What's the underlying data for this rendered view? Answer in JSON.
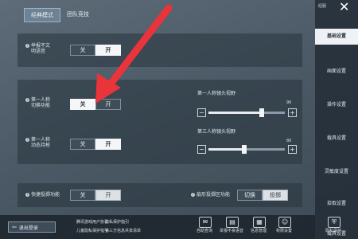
{
  "mode_tabs": {
    "classic": "经典模式",
    "team": "团队竞技"
  },
  "top_bar": {
    "badge": "经服"
  },
  "settings": {
    "report_voice": {
      "label_line1": "举报不文",
      "label_line2": "明语音",
      "off": "关",
      "on": "开"
    },
    "first_person_switch": {
      "label_line1": "第一人称",
      "label_line2": "切换功能",
      "off": "关",
      "on": "开"
    },
    "first_person_hold": {
      "label_line1": "第一人称",
      "label_line2": "动态持枪",
      "off": "关",
      "on": "开"
    },
    "quick_mark": {
      "label": "快捷投掷功能",
      "off": "关",
      "on": "开"
    },
    "throw_mode": {
      "label": "扇形投掷区功能",
      "opt1": "切换",
      "opt2": "投掷"
    }
  },
  "sliders": {
    "first_person_fov": {
      "title": "第一人称镜头视野",
      "value": 90,
      "max_label": "90",
      "min": 60,
      "max": 103,
      "minus": "−",
      "plus": "+"
    },
    "third_person_fov": {
      "title": "第三人称镜头视野",
      "value": 80,
      "max_label": "80",
      "min": 60,
      "max": 103,
      "minus": "−",
      "plus": "+"
    }
  },
  "sidebar": {
    "items": [
      "基础设置",
      "画面设置",
      "操作设置",
      "载具设置",
      "灵敏度设置",
      "拾取设置",
      "载具设置"
    ]
  },
  "footer": {
    "logout": "退出登录",
    "links": [
      "腾讯游戏用户协议",
      "隐私保护指引",
      "儿童隐私保护指引",
      "第三方信息共享清单"
    ],
    "icons": [
      {
        "name": "message-icon",
        "label": "自助查询"
      },
      {
        "name": "book-icon",
        "label": "举报不良语音"
      },
      {
        "name": "data-icon",
        "label": "信息管理"
      },
      {
        "name": "person-icon",
        "label": "权限设置"
      },
      {
        "name": "shield-icon",
        "label": "隐私保护"
      }
    ]
  },
  "colors": {
    "annotation_arrow": "#e8343a",
    "panel": "#28343e",
    "accent_white": "#f4f6f7"
  }
}
